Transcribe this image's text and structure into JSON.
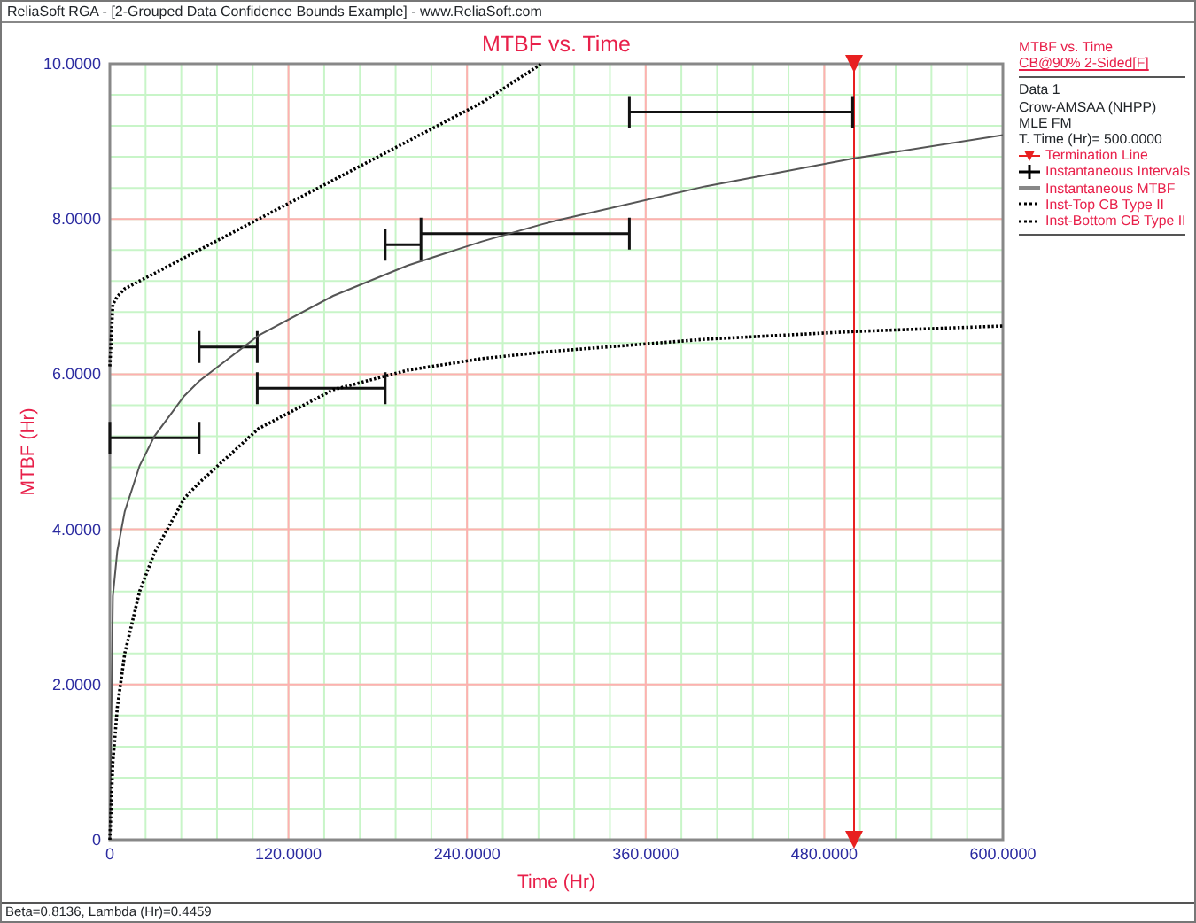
{
  "window": {
    "title": "ReliaSoft RGA - [2-Grouped Data Confidence Bounds Example] - www.ReliaSoft.com"
  },
  "chart": {
    "chart_data": {
      "type": "line",
      "title": "MTBF vs. Time",
      "xlabel": "Time (Hr)",
      "ylabel": "MTBF (Hr)",
      "grid": true,
      "x": [
        0,
        2,
        5,
        10,
        20,
        30,
        50,
        60,
        100,
        150,
        200,
        250,
        290,
        300,
        400,
        500,
        600
      ],
      "series": [
        {
          "name": "Termination Line",
          "color": "#e82020",
          "line_style": "solid",
          "marker": "triangle",
          "x": [
            500,
            500
          ],
          "values": [
            10,
            0
          ]
        },
        {
          "name": "Instantaneous Intervals",
          "color": "#111111",
          "line_style": "solid",
          "x": [
            0,
            60,
            null,
            60,
            99,
            null,
            99,
            185,
            null,
            185,
            209,
            null,
            209,
            349,
            null,
            349,
            499
          ],
          "values": [
            5.18,
            5.18,
            null,
            6.35,
            6.35,
            null,
            5.82,
            5.82,
            null,
            7.67,
            7.67,
            null,
            7.81,
            7.81,
            null,
            9.38,
            9.38
          ]
        },
        {
          "name": "Instantaneous MTBF",
          "color": "#555555",
          "line_style": "solid",
          "values": [
            0,
            3.14,
            3.72,
            4.23,
            4.82,
            5.2,
            5.72,
            5.91,
            6.5,
            7.01,
            7.4,
            7.71,
            7.93,
            7.98,
            8.42,
            8.78,
            9.08
          ]
        },
        {
          "name": "Inst-Top CB Type II",
          "color": "#000000",
          "line_style": "dotted",
          "values": [
            6.1,
            6.9,
            7.0,
            7.1,
            7.2,
            7.3,
            7.5,
            7.6,
            8.0,
            8.5,
            9.0,
            9.5,
            10,
            null,
            null,
            null,
            null
          ]
        },
        {
          "name": "Inst-Bottom CB Type II",
          "color": "#000000",
          "line_style": "dotted",
          "values": [
            0,
            1.0,
            1.7,
            2.4,
            3.2,
            3.7,
            4.4,
            4.6,
            5.3,
            5.8,
            6.05,
            6.2,
            6.28,
            6.3,
            6.45,
            6.55,
            6.62
          ]
        }
      ],
      "xlim": [
        0,
        600
      ],
      "ylim": [
        0,
        10
      ],
      "xticks": [
        {
          "value": 0,
          "label": "0"
        },
        {
          "value": 120,
          "label": "120.0000"
        },
        {
          "value": 240,
          "label": "240.0000"
        },
        {
          "value": 360,
          "label": "360.0000"
        },
        {
          "value": 480,
          "label": "480.0000"
        },
        {
          "value": 600,
          "label": "600.0000"
        }
      ],
      "yticks": [
        {
          "value": 0,
          "label": "0"
        },
        {
          "value": 2,
          "label": "2.0000"
        },
        {
          "value": 4,
          "label": "4.0000"
        },
        {
          "value": 6,
          "label": "6.0000"
        },
        {
          "value": 8,
          "label": "8.0000"
        },
        {
          "value": 10,
          "label": "10.0000"
        }
      ]
    }
  },
  "legend": {
    "title": "MTBF vs. Time",
    "subtitle": "CB@90% 2-Sided[F]",
    "info": [
      "Data 1",
      "Crow-AMSAA (NHPP)",
      "MLE FM",
      "T. Time (Hr)= 500.0000"
    ]
  },
  "status_bar": "Beta=0.8136, Lambda (Hr)=0.4459"
}
